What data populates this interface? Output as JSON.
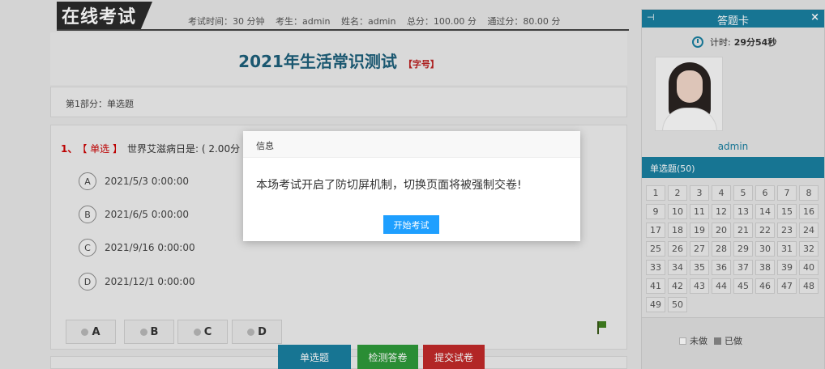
{
  "header": {
    "logo_text": "在线考试",
    "duration": "考试时间：30 分钟",
    "examinee": "考生：admin",
    "name": "姓名：admin",
    "total": "总分：100.00 分",
    "pass": "通过分：80.00 分"
  },
  "exam": {
    "title": "2021年生活常识测试",
    "font_tag": "【字号】",
    "section_label": "第1部分：单选题"
  },
  "question": {
    "number": "1、",
    "type": "【 单选 】",
    "text": "世界艾滋病日是: ( 2.00分 )",
    "options": [
      {
        "letter": "A",
        "text": "2021/5/3 0:00:00"
      },
      {
        "letter": "B",
        "text": "2021/6/5 0:00:00"
      },
      {
        "letter": "C",
        "text": "2021/9/16 0:00:00"
      },
      {
        "letter": "D",
        "text": "2021/12/1 0:00:00"
      }
    ],
    "answer_buttons": [
      "A",
      "B",
      "C",
      "D"
    ]
  },
  "bottom_buttons": [
    {
      "label": "单选题",
      "color": "#1a7fa0"
    },
    {
      "label": "检测答卷",
      "color": "#2e9a3a"
    },
    {
      "label": "提交试卷",
      "color": "#c22a2a"
    }
  ],
  "answer_card": {
    "pin": "⊣",
    "title": "答题卡",
    "close": "×",
    "timer_label": "计时:",
    "timer_value": "29分54秒",
    "username": "admin",
    "section": "单选题(50)",
    "numbers": [
      "1",
      "2",
      "3",
      "4",
      "5",
      "6",
      "7",
      "8",
      "9",
      "10",
      "11",
      "12",
      "13",
      "14",
      "15",
      "16",
      "17",
      "18",
      "19",
      "20",
      "21",
      "22",
      "23",
      "24",
      "25",
      "26",
      "27",
      "28",
      "29",
      "30",
      "31",
      "32",
      "33",
      "34",
      "35",
      "36",
      "37",
      "38",
      "39",
      "40",
      "41",
      "42",
      "43",
      "44",
      "45",
      "46",
      "47",
      "48",
      "49",
      "50"
    ],
    "legend_undone": "未做",
    "legend_done": "已做"
  },
  "dialog": {
    "title": "信息",
    "message": "本场考试开启了防切屏机制，切换页面将被强制交卷!",
    "button": "开始考试"
  },
  "colors": {
    "accent": "#1a7fa0",
    "dialog_button": "#1e9fff",
    "danger": "#c22a2a",
    "success": "#2e9a3a"
  }
}
